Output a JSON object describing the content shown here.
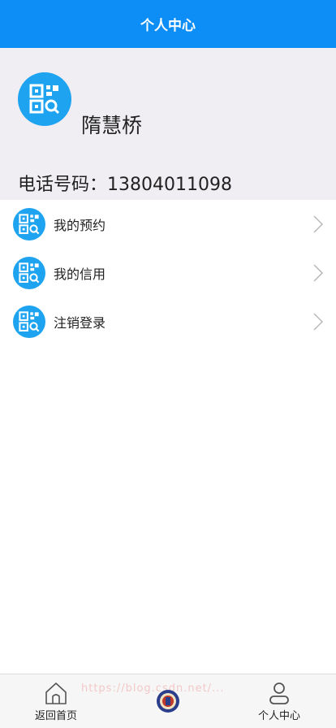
{
  "header": {
    "title": "个人中心"
  },
  "profile": {
    "avatar_icon": "qr-scan-icon",
    "name": "隋慧桥",
    "phone_label": "电话号码：",
    "phone_number": "13804011098"
  },
  "menu": {
    "items": [
      {
        "label": "我的预约",
        "icon": "qr-scan-icon"
      },
      {
        "label": "我的信用",
        "icon": "qr-scan-icon"
      },
      {
        "label": "注销登录",
        "icon": "qr-scan-icon"
      }
    ]
  },
  "tabbar": {
    "home_label": "返回首页",
    "center_icon": "emblem-icon",
    "me_label": "个人中心",
    "watermark": "https://blog.csdn.net/..."
  },
  "colors": {
    "accent": "#0d8ef7",
    "icon_bg": "#1ea3f1",
    "profile_bg": "#f0eef2",
    "tabbar_bg": "#f6f6f6"
  }
}
